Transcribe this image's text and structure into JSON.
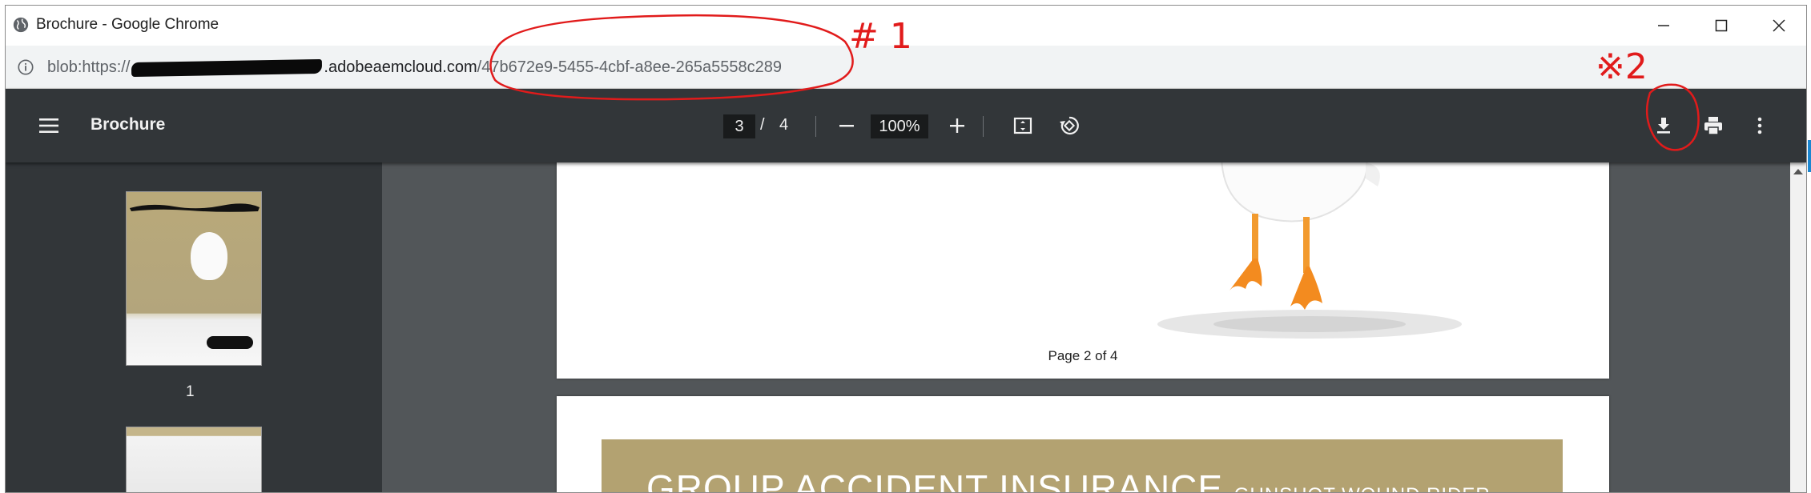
{
  "window": {
    "title": "Brochure - Google Chrome"
  },
  "address_bar": {
    "url_prefix": "blob:https://",
    "url_domain": ".adobeaemcloud.com",
    "url_path": "/47b672e9-5455-4cbf-a8ee-265a5558c289"
  },
  "pdf_toolbar": {
    "title": "Brochure",
    "current_page": "3",
    "page_separator": "/",
    "total_pages": "4",
    "zoom": "100%"
  },
  "sidebar": {
    "thumbnails": [
      {
        "label": "1"
      }
    ]
  },
  "pages": {
    "page2_label": "Page 2 of 4",
    "page3_banner_title": "GROUP ACCIDENT INSURANCE",
    "page3_banner_subtitle": "GUNSHOT WOUND RIDER"
  },
  "annotations": {
    "label1": "# 1",
    "label2": "※2",
    "color": "#e11b1b"
  },
  "icons": [
    "globe-icon",
    "minimize-icon",
    "maximize-icon",
    "close-icon",
    "info-icon",
    "menu-icon",
    "zoom-out-icon",
    "zoom-in-icon",
    "fit-page-icon",
    "rotate-icon",
    "download-icon",
    "print-icon",
    "more-vert-icon"
  ]
}
